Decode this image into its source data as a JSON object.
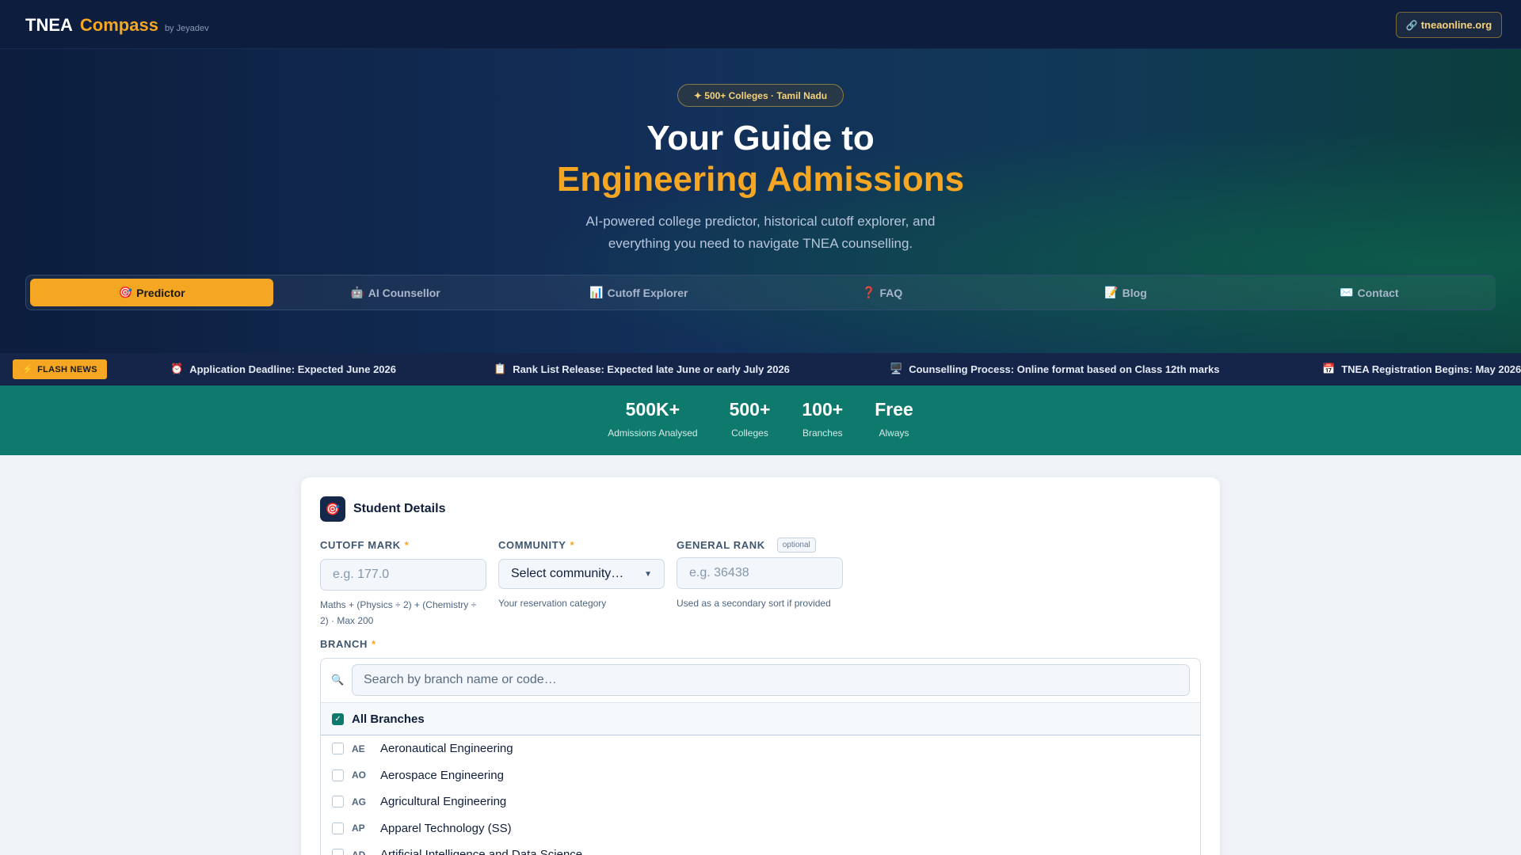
{
  "header": {
    "brand_tnea": "TNEA",
    "brand_compass": "Compass",
    "brand_by": "by Jeyadev",
    "external_link_icon": "🔗",
    "external_link_label": "tneaonline.org"
  },
  "hero": {
    "badge": "✦ 500+ Colleges · Tamil Nadu",
    "title_line1": "Your Guide to",
    "title_line2": "Engineering Admissions",
    "subtitle": "AI-powered college predictor, historical cutoff explorer, and everything you need to navigate TNEA counselling."
  },
  "tabs": [
    {
      "icon": "🎯",
      "label": "Predictor",
      "active": true
    },
    {
      "icon": "🤖",
      "label": "AI Counsellor",
      "active": false
    },
    {
      "icon": "📊",
      "label": "Cutoff Explorer",
      "active": false
    },
    {
      "icon": "❓",
      "label": "FAQ",
      "active": false
    },
    {
      "icon": "📝",
      "label": "Blog",
      "active": false
    },
    {
      "icon": "✉️",
      "label": "Contact",
      "active": false
    }
  ],
  "flash_news": {
    "badge_icon": "⚡",
    "badge_label": "FLASH NEWS",
    "items": [
      {
        "icon": "⏰",
        "text": "Application Deadline: Expected June 2026"
      },
      {
        "icon": "📋",
        "text": "Rank List Release: Expected late June or early July 2026"
      },
      {
        "icon": "🖥️",
        "text": "Counselling Process: Online format based on Class 12th marks"
      },
      {
        "icon": "📅",
        "text": "TNEA Registration Begins: May 2026"
      }
    ]
  },
  "stats": [
    {
      "value": "500K+",
      "label": "Admissions Analysed"
    },
    {
      "value": "500+",
      "label": "Colleges"
    },
    {
      "value": "100+",
      "label": "Branches"
    },
    {
      "value": "Free",
      "label": "Always"
    }
  ],
  "form": {
    "icon": "🎯",
    "title": "Student Details",
    "cutoff": {
      "label": "CUTOFF MARK",
      "required_mark": "*",
      "placeholder": "e.g. 177.0",
      "hint": "Maths + (Physics ÷ 2) + (Chemistry ÷ 2) · Max 200"
    },
    "community": {
      "label": "COMMUNITY",
      "required_mark": "*",
      "selected": "Select community…",
      "hint": "Your reservation category"
    },
    "rank": {
      "label": "GENERAL RANK",
      "optional_tag": "optional",
      "placeholder": "e.g. 36438",
      "hint": "Used as a secondary sort if provided"
    },
    "branch": {
      "label": "BRANCH",
      "required_mark": "*",
      "search_placeholder": "Search by branch name or code…",
      "all_label": "All Branches",
      "all_checked": true,
      "items": [
        {
          "code": "AE",
          "name": "Aeronautical Engineering"
        },
        {
          "code": "AO",
          "name": "Aerospace Engineering"
        },
        {
          "code": "AG",
          "name": "Agricultural Engineering"
        },
        {
          "code": "AP",
          "name": "Apparel Technology (SS)"
        },
        {
          "code": "AD",
          "name": "Artificial Intelligence and Data Science"
        }
      ]
    }
  },
  "colors": {
    "accent": "#f5a623",
    "navy": "#0c1d3d",
    "teal": "#0e7a6e"
  }
}
